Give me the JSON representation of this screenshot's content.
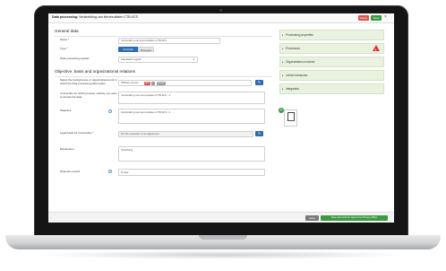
{
  "window": {
    "title_prefix": "Data processing:",
    "title_value": "Verstrekking van leerresultaten CTB-9CS",
    "delete_label": "Delete",
    "save_label": "Save",
    "close_glyph": "×"
  },
  "general": {
    "heading": "General data",
    "name_label": "Name *",
    "name_value": "Verstrekking van leerresultaten CTB-9CS",
    "type_label": "Type *",
    "type_options": [
      "Controller",
      "Processor"
    ],
    "register_label": "Data processing register",
    "register_value": "Standaard register"
  },
  "objective": {
    "heading": "Objective, basis and organizational relations",
    "subprocess_label": "Select the (sub)process or organizational unit in which the data processing takes place",
    "subprocess_value": "Millitrain proces",
    "subprocess_tag1": "Root",
    "subprocess_tag2": "...",
    "subprocess_tag3": "Browse",
    "describe_label": "or describe for which process / activity you want to access the data",
    "describe_value": "Verstrekking van leerresultaten CTB-9CS - 1",
    "objective_label": "Objective",
    "objective_value": "Verstrekking van leerresultaten CTB-9CS - 2",
    "legal_label": "Legal basis for processing *",
    "legal_value": "For the execution of an agreement",
    "explanation_label": "Explanation",
    "explanation_value": "Toelichting",
    "retention_label": "Retention period",
    "retention_value": "10 jaar"
  },
  "panel": {
    "items": [
      "Processing properties",
      "Processors",
      "Organizations involved",
      "Linked measures",
      "Integration"
    ],
    "doc_caption": "Document"
  },
  "footer": {
    "close_label": "Close",
    "approve_label": "Save and send for approval to Privacy officer"
  },
  "colors": {
    "primary": "#2a6db5",
    "success": "#3c9a42",
    "danger": "#d9534f",
    "panel_bg": "#e9f2df"
  }
}
